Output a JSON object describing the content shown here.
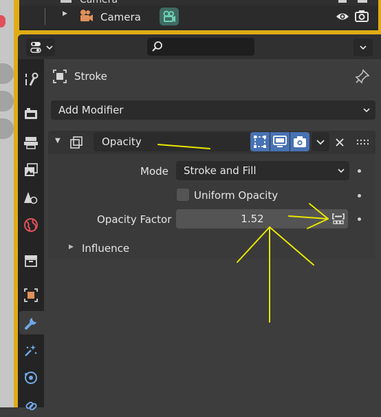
{
  "outliner": {
    "partial_row_label": "Camera",
    "row_label": "Camera"
  },
  "properties": {
    "context_label": "Stroke",
    "add_modifier_label": "Add Modifier"
  },
  "modifier": {
    "name_value": "Opacity",
    "mode_label": "Mode",
    "mode_value": "Stroke and Fill",
    "uniform_opacity_label": "Uniform Opacity",
    "opacity_factor_label": "Opacity Factor",
    "opacity_factor_value": "1.52",
    "influence_label": "Influence"
  },
  "colors": {
    "annotation": "#e8e800",
    "accent_blue": "#4772b3",
    "active_tab_icon": "#71a8e8",
    "frame_yellow": "#e0ac16"
  },
  "icons": [
    "expand-arrow-icon",
    "camera-object-icon",
    "camera-data-icon",
    "eye-icon",
    "render-camera-icon",
    "editor-type-icon",
    "search-icon",
    "chevron-down-icon",
    "tool-icon",
    "render-icon",
    "output-icon",
    "view-layer-icon",
    "scene-icon",
    "world-icon",
    "collection-icon",
    "object-icon",
    "modifier-wrench-icon",
    "particles-icon",
    "physics-icon",
    "constraints-icon",
    "stroke-icon",
    "pin-icon",
    "edit-mode-icon",
    "viewport-icon",
    "render-toggle-icon",
    "close-icon",
    "drag-handle-icon",
    "driver-icon"
  ]
}
